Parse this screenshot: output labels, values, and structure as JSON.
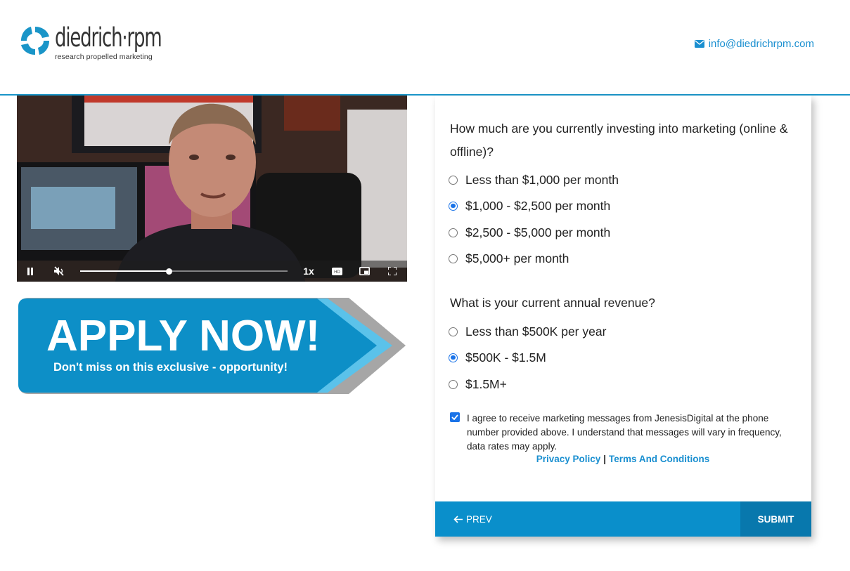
{
  "header": {
    "logo_name": "diedrich·rpm",
    "logo_tagline": "research propelled marketing",
    "email": "info@diedrichrpm.com"
  },
  "video": {
    "speed": "1x",
    "progress": 0.43,
    "icons": [
      "pause-icon",
      "mute-icon",
      "hd-icon",
      "picture-in-picture-icon",
      "fullscreen-icon"
    ]
  },
  "banner": {
    "title": "APPLY NOW!",
    "subtitle": "Don't miss on this exclusive - opportunity!"
  },
  "form": {
    "q1": {
      "label": "How much are you currently investing into marketing (online & offline)?",
      "options": [
        "Less than $1,000 per month",
        "$1,000 - $2,500 per month",
        "$2,500 - $5,000 per month",
        "$5,000+ per month"
      ],
      "selected": 1
    },
    "q2": {
      "label": "What is your current annual revenue?",
      "options": [
        "Less than $500K per year",
        "$500K - $1.5M",
        "$1.5M+"
      ],
      "selected": 1
    },
    "consent": {
      "checked": true,
      "text": "I agree to receive marketing messages from JenesisDigital at the phone number provided above. I understand that messages will vary in frequency, data rates may apply."
    },
    "links": {
      "privacy": "Privacy Policy",
      "separator": "|",
      "terms": "Terms And Conditions"
    },
    "prev_label": "PREV",
    "submit_label": "SUBMIT"
  },
  "colors": {
    "accent": "#0a8fcb",
    "link": "#1a8fd0",
    "radio": "#1a73e8"
  }
}
